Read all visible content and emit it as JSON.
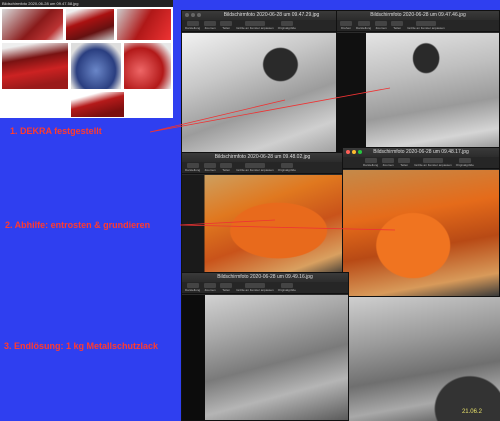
{
  "labels": {
    "dekra": "1.  DEKRA   festgestellt",
    "abhilfe": "2.  Abhilfe: entrosten & grundieren",
    "endloesung": "3. Endlösung:  1 kg Metallschutzlack"
  },
  "windows": {
    "thumbs": {
      "title": "Bildschirmfoto 2020-06-28 um 09.47.58.jpg"
    },
    "w1": {
      "title": "Bildschirmfoto 2020-06-28 um 09.47.29.jpg"
    },
    "w2": {
      "title": "Bildschirmfoto 2020-06-28 um 09.47.46.jpg"
    },
    "w3": {
      "title": "Bildschirmfoto 2020-06-28 um 09.48.02.jpg"
    },
    "w4": {
      "title": "Bildschirmfoto 2020-06-28 um 09.48.17.jpg"
    },
    "w5": {
      "title": "Bildschirmfoto 2020-06-28 um 09.49.16.jpg"
    }
  },
  "toolbar": {
    "darstellung": "Darstellung",
    "zoomen": "Zoomen",
    "teilen": "Teilen",
    "groesse": "Größe an Fenster anpassen",
    "originalgroesse": "Originalgröße",
    "drehen": "Drehen"
  },
  "photo_text": {
    "date_stamp": "21.06.2"
  },
  "colors": {
    "background": "#2f3ff0",
    "label_red": "#ff3b2f",
    "window_dark": "#2b2b2b"
  }
}
